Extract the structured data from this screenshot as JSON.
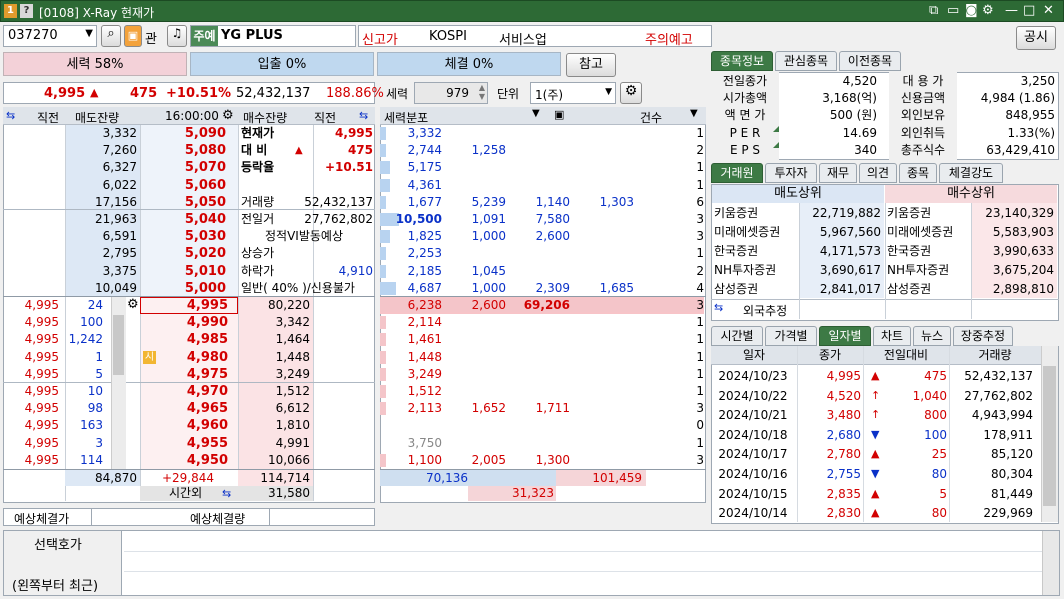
{
  "window": {
    "title": "[0108] X-Ray 현재가"
  },
  "top": {
    "code": "037270",
    "btn_gwan": "관",
    "market_badge": "주예",
    "stock_name": "YG PLUS",
    "new_high": "신고가",
    "market": "KOSPI",
    "sector": "서비스업",
    "caution": "주의예고",
    "share_btn": "공시"
  },
  "gauges": {
    "power": "세력 58%",
    "inout": "입출 0%",
    "exec": "체결 0%",
    "ref_btn": "참고"
  },
  "price_line": {
    "price": "4,995",
    "arrow": "▲",
    "diff": "475",
    "rate": "+10.51%",
    "volume": "52,432,137",
    "ratio": "188.86%"
  },
  "power_unit": {
    "label": "세력",
    "value": "979",
    "unit_label": "단위",
    "unit_value": "1(주)"
  },
  "orderbook": {
    "headers": {
      "prev": "직전",
      "ask_rem": "매도잔량",
      "time": "16:00:00",
      "bid_rem": "매수잔량",
      "prev2": "직전"
    },
    "asks": [
      {
        "qty": "3,332",
        "price": "5,090"
      },
      {
        "qty": "7,260",
        "price": "5,080"
      },
      {
        "qty": "6,327",
        "price": "5,070"
      },
      {
        "qty": "6,022",
        "price": "5,060"
      },
      {
        "qty": "17,156",
        "price": "5,050"
      },
      {
        "qty": "21,963",
        "price": "5,040"
      },
      {
        "qty": "6,591",
        "price": "5,030"
      },
      {
        "qty": "2,795",
        "price": "5,020"
      },
      {
        "qty": "3,375",
        "price": "5,010"
      },
      {
        "qty": "10,049",
        "price": "5,000"
      }
    ],
    "info": [
      {
        "label": "현재가",
        "value": "4,995"
      },
      {
        "label": "대 비",
        "value": "475",
        "arrow": "▲"
      },
      {
        "label": "등락율",
        "value": "+10.51"
      },
      {
        "label": "",
        "value": ""
      },
      {
        "label": "거래량",
        "value": "52,432,137"
      },
      {
        "label": "전일거",
        "value": "27,762,802"
      },
      {
        "label": "정적VI발동예상",
        "value": ""
      },
      {
        "label": "상승가",
        "value": ""
      },
      {
        "label": "하락가",
        "value": "4,910"
      },
      {
        "label": "일반( 40% )/신용불가",
        "value": ""
      }
    ],
    "bids": [
      {
        "pp": "4,995",
        "pq": "24",
        "price": "4,995",
        "qty": "80,220"
      },
      {
        "pp": "4,995",
        "pq": "100",
        "price": "4,990",
        "qty": "3,342"
      },
      {
        "pp": "4,995",
        "pq": "1,242",
        "price": "4,985",
        "qty": "1,464"
      },
      {
        "pp": "4,995",
        "pq": "1",
        "price": "4,980",
        "qty": "1,448",
        "flag": "시"
      },
      {
        "pp": "4,995",
        "pq": "5",
        "price": "4,975",
        "qty": "3,249"
      },
      {
        "pp": "4,995",
        "pq": "10",
        "price": "4,970",
        "qty": "1,512"
      },
      {
        "pp": "4,995",
        "pq": "98",
        "price": "4,965",
        "qty": "6,612"
      },
      {
        "pp": "4,995",
        "pq": "163",
        "price": "4,960",
        "qty": "1,810"
      },
      {
        "pp": "4,995",
        "pq": "3",
        "price": "4,955",
        "qty": "4,991"
      },
      {
        "pp": "4,995",
        "pq": "114",
        "price": "4,950",
        "qty": "10,066"
      }
    ],
    "total_ask": "84,870",
    "total_diff": "+29,844",
    "total_bid": "114,714",
    "after_label": "시간외",
    "after_value": "31,580",
    "exp_price_label": "예상체결가",
    "exp_qty_label": "예상체결량"
  },
  "dist": {
    "header": "세력분포",
    "count_header": "건수",
    "rows": [
      {
        "a": "3,332",
        "b": "",
        "c": "",
        "d": "",
        "n": "1",
        "bar": 0.02
      },
      {
        "a": "2,744",
        "b": "1,258",
        "c": "",
        "d": "",
        "n": "2",
        "bar": 0.02
      },
      {
        "a": "5,175",
        "b": "",
        "c": "",
        "d": "",
        "n": "1",
        "bar": 0.03
      },
      {
        "a": "4,361",
        "b": "",
        "c": "",
        "d": "",
        "n": "1",
        "bar": 0.03
      },
      {
        "a": "1,677",
        "b": "5,239",
        "c": "1,140",
        "d": "1,303",
        "n": "6",
        "bar": 0.02
      },
      {
        "a": "10,500",
        "b": "1,091",
        "c": "7,580",
        "d": "",
        "n": "3",
        "bar": 0.06,
        "boldA": true
      },
      {
        "a": "1,825",
        "b": "1,000",
        "c": "2,600",
        "d": "",
        "n": "3",
        "bar": 0.03
      },
      {
        "a": "2,253",
        "b": "",
        "c": "",
        "d": "",
        "n": "1",
        "bar": 0.02
      },
      {
        "a": "2,185",
        "b": "1,045",
        "c": "",
        "d": "",
        "n": "2",
        "bar": 0.02
      },
      {
        "a": "4,687",
        "b": "1,000",
        "c": "2,309",
        "d": "1,685",
        "n": "4",
        "bar": 0.05
      },
      {
        "a": "6,238",
        "b": "2,600",
        "c": "69,206",
        "d": "",
        "n": "3",
        "bar": 1.0,
        "hl": true
      },
      {
        "a": "2,114",
        "b": "",
        "c": "",
        "d": "",
        "n": "1",
        "bar": 0.02
      },
      {
        "a": "1,461",
        "b": "",
        "c": "",
        "d": "",
        "n": "1",
        "bar": 0.02
      },
      {
        "a": "1,448",
        "b": "",
        "c": "",
        "d": "",
        "n": "1",
        "bar": 0.02
      },
      {
        "a": "3,249",
        "b": "",
        "c": "",
        "d": "",
        "n": "1",
        "bar": 0.02
      },
      {
        "a": "1,512",
        "b": "",
        "c": "",
        "d": "",
        "n": "1",
        "bar": 0.02
      },
      {
        "a": "2,113",
        "b": "1,652",
        "c": "1,711",
        "d": "",
        "n": "3",
        "bar": 0.02
      },
      {
        "a": "",
        "b": "",
        "c": "",
        "d": "",
        "n": "0",
        "bar": 0
      },
      {
        "a": "3,750",
        "b": "",
        "c": "",
        "d": "",
        "n": "1",
        "bar": 0,
        "gray": true
      },
      {
        "a": "1,100",
        "b": "2,005",
        "c": "1,300",
        "d": "",
        "n": "3",
        "bar": 0.02
      }
    ],
    "tot_ask": "70,136",
    "tot_bid": "101,459",
    "tot_diff": "31,323"
  },
  "info_tabs": [
    "종목정보",
    "관심종목",
    "이전종목"
  ],
  "info": [
    {
      "l1": "전일종가",
      "v1": "4,520",
      "l2": "대 용 가",
      "v2": "3,250"
    },
    {
      "l1": "시가총액",
      "v1": "3,168(억)",
      "l2": "신용금액",
      "v2": "4,984  (1.86)"
    },
    {
      "l1": "액 면 가",
      "v1": "500 (원)",
      "l2": "외인보유",
      "v2": "848,955"
    },
    {
      "l1": "P E R",
      "v1": "14.69",
      "l2": "외인취득",
      "v2": "1.33(%)"
    },
    {
      "l1": "E P S",
      "v1": "340",
      "l2": "총주식수",
      "v2": "63,429,410"
    }
  ],
  "broker_tabs": [
    "거래원",
    "투자자",
    "재무",
    "의견",
    "종목",
    "체결강도"
  ],
  "brokers": {
    "sell_header": "매도상위",
    "buy_header": "매수상위",
    "rows": [
      {
        "s": "키움증권",
        "sq": "22,719,882",
        "b": "키움증권",
        "bq": "23,140,329"
      },
      {
        "s": "미래에셋증권",
        "sq": "5,967,560",
        "b": "미래에셋증권",
        "bq": "5,583,903"
      },
      {
        "s": "한국증권",
        "sq": "4,171,573",
        "b": "한국증권",
        "bq": "3,990,633"
      },
      {
        "s": "NH투자증권",
        "sq": "3,690,617",
        "b": "NH투자증권",
        "bq": "3,675,204"
      },
      {
        "s": "삼성증권",
        "sq": "2,841,017",
        "b": "삼성증권",
        "bq": "2,898,810"
      }
    ],
    "foreign": "외국추정"
  },
  "day_tabs": [
    "시간별",
    "가격별",
    "일자별",
    "차트",
    "뉴스",
    "장중추정"
  ],
  "daily": {
    "headers": [
      "일자",
      "종가",
      "전일대비",
      "거래량"
    ],
    "rows": [
      {
        "date": "2024/10/23",
        "close": "4,995",
        "sym": "▲",
        "diff": "475",
        "vol": "52,432,137",
        "dir": "up"
      },
      {
        "date": "2024/10/22",
        "close": "4,520",
        "sym": "↑",
        "diff": "1,040",
        "vol": "27,762,802",
        "dir": "up"
      },
      {
        "date": "2024/10/21",
        "close": "3,480",
        "sym": "↑",
        "diff": "800",
        "vol": "4,943,994",
        "dir": "up"
      },
      {
        "date": "2024/10/18",
        "close": "2,680",
        "sym": "▼",
        "diff": "100",
        "vol": "178,911",
        "dir": "down"
      },
      {
        "date": "2024/10/17",
        "close": "2,780",
        "sym": "▲",
        "diff": "25",
        "vol": "85,120",
        "dir": "up"
      },
      {
        "date": "2024/10/16",
        "close": "2,755",
        "sym": "▼",
        "diff": "80",
        "vol": "80,304",
        "dir": "down"
      },
      {
        "date": "2024/10/15",
        "close": "2,835",
        "sym": "▲",
        "diff": "5",
        "vol": "81,449",
        "dir": "up"
      },
      {
        "date": "2024/10/14",
        "close": "2,830",
        "sym": "▲",
        "diff": "80",
        "vol": "229,969",
        "dir": "up"
      }
    ]
  },
  "bottom": {
    "sel_label": "선택호가",
    "sub_label": "(왼쪽부터 최근)"
  }
}
